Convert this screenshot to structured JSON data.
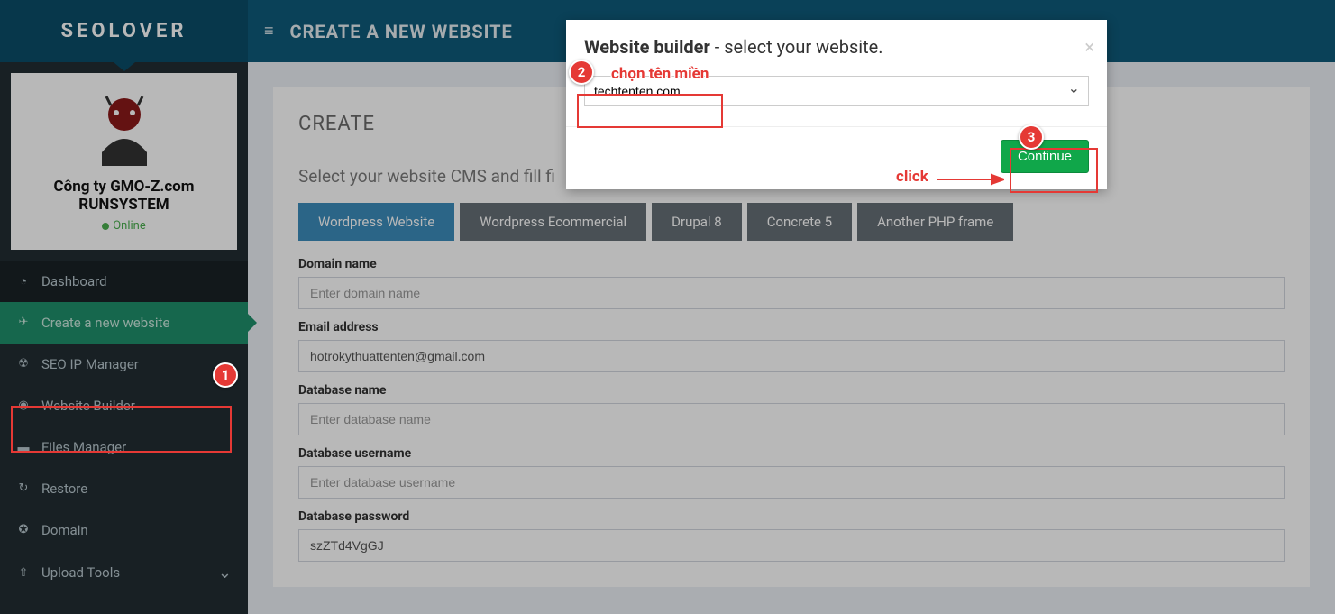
{
  "brand": "SEOLOVER",
  "page_title_top": "CREATE A NEW WEBSITE",
  "user": {
    "company": "Công ty GMO-Z.com RUNSYSTEM",
    "status": "Online"
  },
  "sidebar": {
    "dashboard": "Dashboard",
    "create": "Create a new website",
    "seoip": "SEO IP Manager",
    "builder": "Website Builder",
    "files": "Files Manager",
    "restore": "Restore",
    "domain": "Domain",
    "upload": "Upload Tools"
  },
  "main": {
    "heading": "CREATE",
    "subtitle": "Select your website CMS and fill fi",
    "tabs": [
      "Wordpress Website",
      "Wordpress Ecommercial",
      "Drupal 8",
      "Concrete 5",
      "Another PHP frame"
    ],
    "fields": {
      "domain_label": "Domain name",
      "domain_placeholder": "Enter domain name",
      "domain_value": "",
      "email_label": "Email address",
      "email_value": "hotrokythuattenten@gmail.com",
      "dbname_label": "Database name",
      "dbname_placeholder": "Enter database name",
      "dbname_value": "",
      "dbuser_label": "Database username",
      "dbuser_placeholder": "Enter database username",
      "dbuser_value": "",
      "dbpass_label": "Database password",
      "dbpass_value": "szZTd4VgGJ"
    }
  },
  "modal": {
    "title_bold": "Website builder",
    "title_rest": " - select your website.",
    "selected": "techtenten.com",
    "continue": "Continue"
  },
  "anno": {
    "n1": "1",
    "n2": "2",
    "n3": "3",
    "text2": "chọn tên miền",
    "text3": "click"
  }
}
